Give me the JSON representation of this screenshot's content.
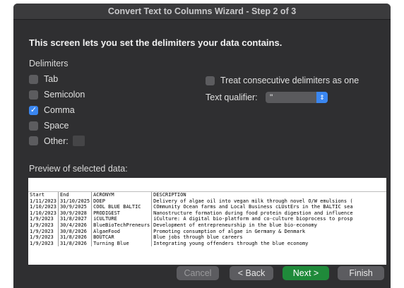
{
  "window": {
    "title": "Convert Text to Columns Wizard - Step 2 of 3"
  },
  "intro": "This screen lets you set the delimiters your data contains.",
  "delimiters": {
    "label": "Delimiters",
    "tab": {
      "label": "Tab",
      "checked": false
    },
    "semicolon": {
      "label": "Semicolon",
      "checked": false
    },
    "comma": {
      "label": "Comma",
      "checked": true
    },
    "space": {
      "label": "Space",
      "checked": false
    },
    "other": {
      "label": "Other:",
      "checked": false,
      "value": ""
    }
  },
  "options": {
    "consecutive": {
      "label": "Treat consecutive delimiters as one",
      "checked": false
    },
    "qualifier": {
      "label": "Text qualifier:",
      "value": "\""
    }
  },
  "preview": {
    "label": "Preview of selected data:",
    "rows": [
      [
        "Start",
        "End",
        "ACRONYM",
        "DESCRIPTION"
      ],
      [
        "1/11/2023",
        "31/10/2025",
        "DOEP",
        "Delivery of algae oil into vegan milk through novel O/W emulsions ("
      ],
      [
        "1/10/2023",
        "30/9/2025",
        "COOL BLUE BALTIC",
        "COmmunity Ocean farms and Local Business cLUstErs in the BALTIC sea"
      ],
      [
        "1/10/2023",
        "30/9/2028",
        "PRODIGEST",
        "Nanostructure formation during food protein digestion and influence"
      ],
      [
        "1/9/2023",
        "31/8/2027",
        "iCULTURE",
        "iCulture: A digital bio-platform and co-culture bioprocess to prosp"
      ],
      [
        "1/9/2023",
        "30/4/2026",
        "BlueBioTechPreneurs",
        "Development of entrepreneurship in the blue bio-economy"
      ],
      [
        "1/9/2023",
        "30/8/2026",
        "AlgaeFood",
        "Promoting consumption of algae in Germany & Denmark"
      ],
      [
        "1/9/2023",
        "31/8/2026",
        "BOUTCAR",
        "Blue jobs through blue careers"
      ],
      [
        "1/9/2023",
        "31/8/2026",
        "Turning Blue",
        "Integrating young offenders through the blue economy"
      ]
    ]
  },
  "buttons": {
    "cancel": "Cancel",
    "back": "< Back",
    "next": "Next >",
    "finish": "Finish"
  }
}
